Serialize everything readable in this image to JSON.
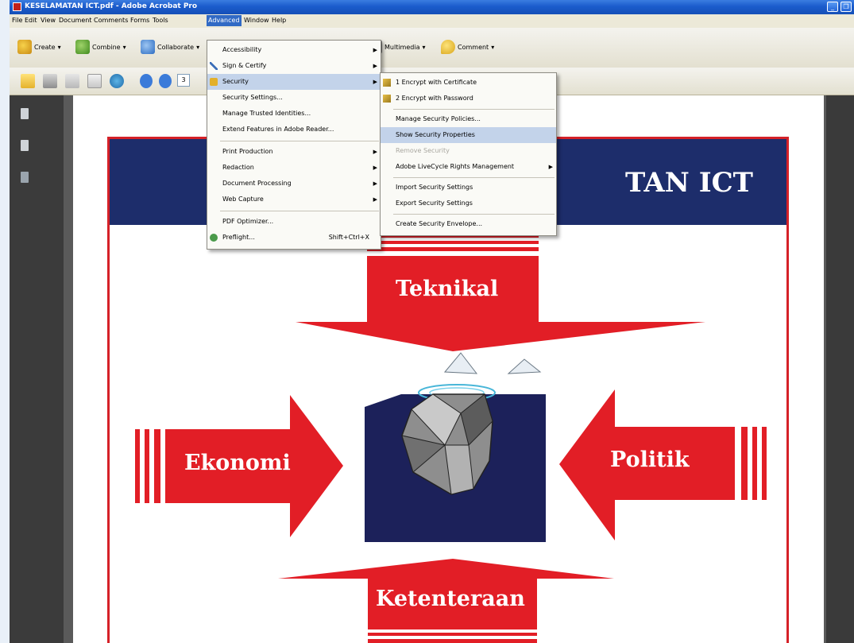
{
  "window": {
    "title": "KESELAMATAN ICT.pdf - Adobe Acrobat Pro"
  },
  "menubar": {
    "items": [
      "File",
      "Edit",
      "View",
      "Document",
      "Comments",
      "Forms",
      "Tools",
      "Advanced",
      "Window",
      "Help"
    ],
    "active": "Advanced"
  },
  "toolbar": {
    "create": "Create",
    "combine": "Combine",
    "collaborate": "Collaborate",
    "multimedia": "Multimedia",
    "comment": "Comment",
    "page_number": "3"
  },
  "advanced_menu": {
    "items": [
      {
        "label": "Accessibility",
        "submenu": true
      },
      {
        "label": "Sign & Certify",
        "submenu": true
      },
      {
        "label": "Security",
        "submenu": true,
        "highlighted": true
      },
      {
        "label": "Security Settings..."
      },
      {
        "label": "Manage Trusted Identities..."
      },
      {
        "label": "Extend Features in Adobe Reader..."
      },
      {
        "label": "Print Production",
        "submenu": true
      },
      {
        "label": "Redaction",
        "submenu": true
      },
      {
        "label": "Document Processing",
        "submenu": true
      },
      {
        "label": "Web Capture",
        "submenu": true
      },
      {
        "label": "PDF Optimizer..."
      },
      {
        "label": "Preflight...",
        "shortcut": "Shift+Ctrl+X"
      }
    ]
  },
  "security_submenu": {
    "items": [
      {
        "label": "1 Encrypt with Certificate"
      },
      {
        "label": "2 Encrypt with Password"
      },
      {
        "label": "Manage Security Policies..."
      },
      {
        "label": "Show Security Properties",
        "highlighted": true
      },
      {
        "label": "Remove Security",
        "disabled": true
      },
      {
        "label": "Adobe LiveCycle Rights Management",
        "submenu": true
      },
      {
        "label": "Import Security Settings"
      },
      {
        "label": "Export Security Settings"
      },
      {
        "label": "Create Security Envelope..."
      }
    ]
  },
  "slide": {
    "banner_title": "TAN ICT",
    "top_label": "Teknikal",
    "left_label": "Ekonomi",
    "right_label": "Politik",
    "bottom_label": "Ketenteraan"
  },
  "colors": {
    "accent_red": "#e21e26",
    "banner_navy": "#1d2d6b",
    "menu_highlight": "#c3d3ea",
    "menubar_active": "#316ac5"
  }
}
